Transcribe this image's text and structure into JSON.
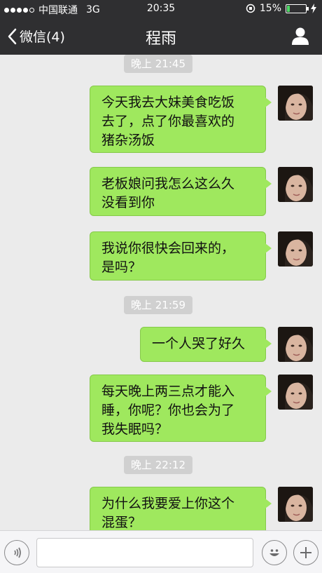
{
  "status_bar": {
    "carrier": "中国联通",
    "network": "3G",
    "time": "20:35",
    "battery_percent": "15%",
    "battery_level": 0.15
  },
  "nav": {
    "back_label": "微信(4)",
    "title": "程雨"
  },
  "timestamps": [
    "晚上 21:45",
    "晚上 21:59",
    "晚上 22:12"
  ],
  "messages": [
    {
      "lines": [
        "今天我去大妹美食吃饭",
        "去了，点了你最喜欢的",
        "猪杂汤饭"
      ]
    },
    {
      "lines": [
        "老板娘问我怎么这么久",
        "没看到你"
      ]
    },
    {
      "lines": [
        "我说你很快会回来的，",
        "是吗？"
      ]
    },
    {
      "lines": [
        "一个人哭了好久"
      ]
    },
    {
      "lines": [
        "每天晚上两三点才能入",
        "睡，你呢？你也会为了",
        "我失眠吗？"
      ]
    },
    {
      "lines": [
        "为什么我要爱上你这个",
        "混蛋？"
      ]
    }
  ],
  "colors": {
    "bubble": "#9fe85e",
    "nav_bg": "#2f2f31",
    "chat_bg": "#ebebeb"
  }
}
